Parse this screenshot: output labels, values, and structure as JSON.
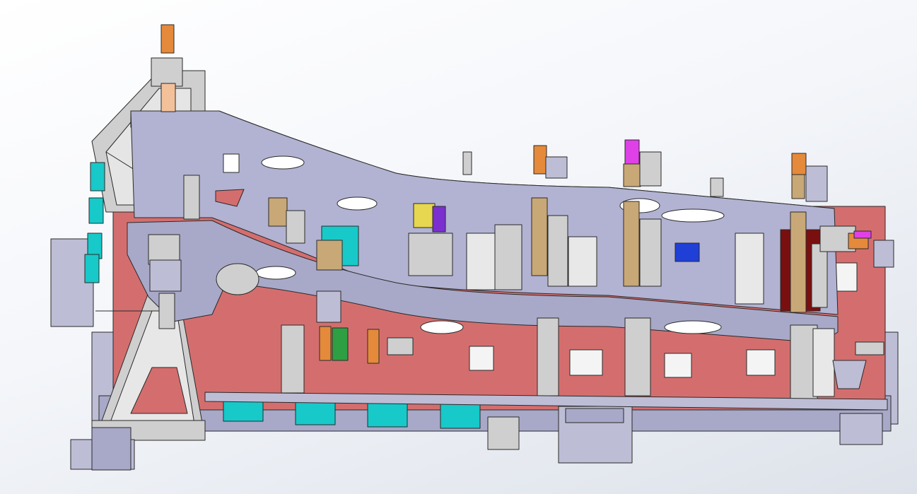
{
  "viewport": {
    "background_top": "#ffffff",
    "background_bottom": "#dde2ea"
  },
  "colors": {
    "frame_lavender": "#a8a8c8",
    "base_salmon": "#d46e6e",
    "stand_gray": "#cfcfcf",
    "cyan_block": "#17c9c9",
    "copper": "#e58a3a",
    "tan": "#c9a877",
    "maroon": "#7a0f0f",
    "blue": "#1f3fd6",
    "magenta": "#e040e8",
    "green": "#2ea043",
    "purple": "#7b2fd1",
    "edge": "#2a2a2a"
  },
  "icons": [
    "triad-icon"
  ]
}
